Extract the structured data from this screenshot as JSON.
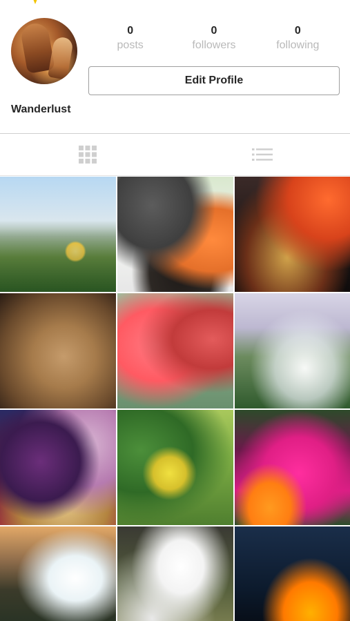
{
  "header": {
    "username": "Wanderlust"
  },
  "stats": [
    {
      "value": "0",
      "label": "posts"
    },
    {
      "value": "0",
      "label": "followers"
    },
    {
      "value": "0",
      "label": "following"
    }
  ],
  "actions": {
    "edit_profile_label": "Edit Profile"
  },
  "tabs": [
    {
      "icon": "grid-icon",
      "active": true
    },
    {
      "icon": "list-icon",
      "active": false
    }
  ],
  "grid": {
    "tiles": [
      {
        "subject": "coastal-flower"
      },
      {
        "subject": "seedling-and-pots"
      },
      {
        "subject": "street-market-at-night"
      },
      {
        "subject": "lioness"
      },
      {
        "subject": "flamingo"
      },
      {
        "subject": "waterfall"
      },
      {
        "subject": "star-lanterns"
      },
      {
        "subject": "leaves"
      },
      {
        "subject": "magenta-flowers"
      },
      {
        "subject": "waterfall-canyon"
      },
      {
        "subject": "rushing-water"
      },
      {
        "subject": "flame"
      }
    ]
  },
  "colors": {
    "text": "#262626",
    "muted": "#b9b9b9",
    "border": "#9e9e9e",
    "accent": "#f2c300"
  }
}
